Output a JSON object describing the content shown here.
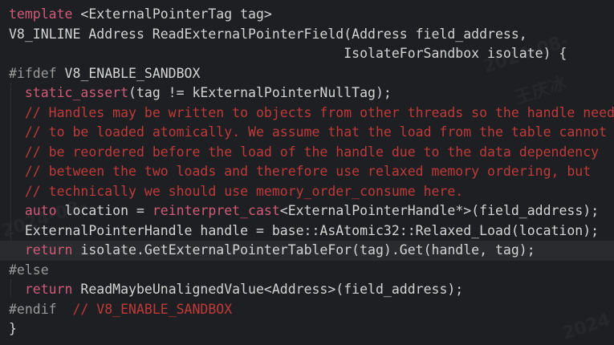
{
  "colors": {
    "background": "#1e1f22",
    "keyword": "#d25a78",
    "comment": "#c03a3a",
    "preprocessor": "#9a9a9a",
    "identifier": "#d4d4d4",
    "current_line": "#2a2b2f"
  },
  "code": {
    "lines": [
      {
        "tokens": [
          {
            "t": "kw",
            "text": "template"
          },
          {
            "t": "id",
            "text": " <ExternalPointerTag tag>"
          }
        ]
      },
      {
        "tokens": [
          {
            "t": "id",
            "text": "V8_INLINE Address ReadExternalPointerField(Address field_address,"
          }
        ]
      },
      {
        "tokens": [
          {
            "t": "id",
            "text": "                                          IsolateForSandbox isolate) {"
          }
        ]
      },
      {
        "tokens": [
          {
            "t": "pp",
            "text": "#ifdef"
          },
          {
            "t": "id",
            "text": " V8_ENABLE_SANDBOX"
          }
        ]
      },
      {
        "tokens": [
          {
            "t": "id",
            "text": "  "
          },
          {
            "t": "kw",
            "text": "static_assert"
          },
          {
            "t": "id",
            "text": "(tag != kExternalPointerNullTag);"
          }
        ]
      },
      {
        "tokens": [
          {
            "t": "id",
            "text": "  "
          },
          {
            "t": "cm",
            "text": "// Handles may be written to objects from other threads so the handle needs"
          }
        ]
      },
      {
        "tokens": [
          {
            "t": "id",
            "text": "  "
          },
          {
            "t": "cm",
            "text": "// to be loaded atomically. We assume that the load from the table cannot"
          }
        ]
      },
      {
        "tokens": [
          {
            "t": "id",
            "text": "  "
          },
          {
            "t": "cm",
            "text": "// be reordered before the load of the handle due to the data dependency"
          }
        ]
      },
      {
        "tokens": [
          {
            "t": "id",
            "text": "  "
          },
          {
            "t": "cm",
            "text": "// between the two loads and therefore use relaxed memory ordering, but"
          }
        ]
      },
      {
        "tokens": [
          {
            "t": "id",
            "text": "  "
          },
          {
            "t": "cm",
            "text": "// technically we should use memory_order_consume here."
          }
        ]
      },
      {
        "tokens": [
          {
            "t": "id",
            "text": "  "
          },
          {
            "t": "kw",
            "text": "auto"
          },
          {
            "t": "id",
            "text": " location = "
          },
          {
            "t": "kw",
            "text": "reinterpret_cast"
          },
          {
            "t": "id",
            "text": "<ExternalPointerHandle*>(field_address);"
          }
        ]
      },
      {
        "tokens": [
          {
            "t": "id",
            "text": "  ExternalPointerHandle handle = base::AsAtomic32::Relaxed_Load(location);"
          }
        ]
      },
      {
        "current": true,
        "tokens": [
          {
            "t": "id",
            "text": "  "
          },
          {
            "t": "kw",
            "text": "return"
          },
          {
            "t": "id",
            "text": " isolate.GetExternalPointerTableFor(tag).Get(handle, tag);"
          }
        ]
      },
      {
        "tokens": [
          {
            "t": "pp",
            "text": "#else"
          }
        ]
      },
      {
        "tokens": [
          {
            "t": "id",
            "text": "  "
          },
          {
            "t": "kw",
            "text": "return"
          },
          {
            "t": "id",
            "text": " ReadMaybeUnalignedValue<Address>(field_address);"
          }
        ]
      },
      {
        "tokens": [
          {
            "t": "pp",
            "text": "#endif"
          },
          {
            "t": "id",
            "text": "  "
          },
          {
            "t": "cm",
            "text": "// V8_ENABLE_SANDBOX"
          }
        ]
      },
      {
        "tokens": [
          {
            "t": "id",
            "text": "}"
          }
        ]
      }
    ]
  },
  "watermark": {
    "date_text": "2024-08-",
    "name_text": "王庆冰",
    "year_text": "2024"
  }
}
